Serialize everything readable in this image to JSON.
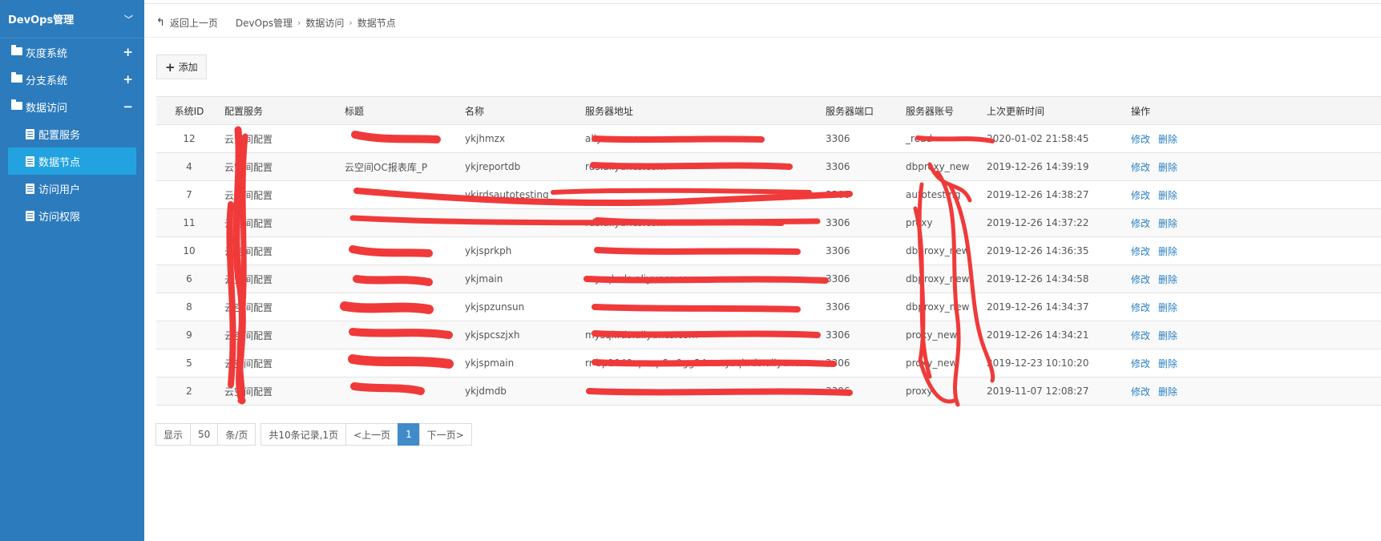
{
  "sidebar": {
    "title": "DevOps管理",
    "groups": [
      {
        "label": "灰度系统",
        "sign": "+"
      },
      {
        "label": "分支系统",
        "sign": "+"
      },
      {
        "label": "数据访问",
        "sign": "−"
      }
    ],
    "sub_items": [
      {
        "label": "配置服务"
      },
      {
        "label": "数据节点"
      },
      {
        "label": "访问用户"
      },
      {
        "label": "访问权限"
      }
    ]
  },
  "breadcrumb": {
    "back": "返回上一页",
    "items": [
      "DevOps管理",
      "数据访问",
      "数据节点"
    ]
  },
  "toolbar": {
    "add_label": "添加"
  },
  "table": {
    "headers": [
      "系统ID",
      "配置服务",
      "标题",
      "名称",
      "服务器地址",
      "服务器端口",
      "服务器账号",
      "上次更新时间",
      "操作"
    ],
    "rows": [
      {
        "id": "12",
        "service": "云空间配置",
        "title": "",
        "name": "ykjhmzx",
        "addr": "aliyuncs.com",
        "port": "3306",
        "account": "_read",
        "updated": "2020-01-02 21:58:45"
      },
      {
        "id": "4",
        "service": "云空间配置",
        "title": "云空间OC报表库_P",
        "name": "ykjreportdb",
        "addr": "rds.aliyuncs.com",
        "port": "3306",
        "account": "dbproxy_new",
        "updated": "2019-12-26 14:39:19"
      },
      {
        "id": "7",
        "service": "云空间配置",
        "title": "",
        "name": "ykjrdsautotesting",
        "addr": "",
        "port": "3306",
        "account": "autotesting",
        "updated": "2019-12-26 14:38:27"
      },
      {
        "id": "11",
        "service": "云空间配置",
        "title": "",
        "name": "",
        "addr": "rds.aliyuncs.com",
        "port": "3306",
        "account": "proxy",
        "updated": "2019-12-26 14:37:22"
      },
      {
        "id": "10",
        "service": "云空间配置",
        "title": "",
        "name": "ykjsprkph",
        "addr": "",
        "port": "3306",
        "account": "dbproxy_new",
        "updated": "2019-12-26 14:36:35"
      },
      {
        "id": "6",
        "service": "云空间配置",
        "title": "",
        "name": "ykjmain",
        "addr": "mysql.rds.aliyuncs.com",
        "port": "3306",
        "account": "dbproxy_new",
        "updated": "2019-12-26 14:34:58"
      },
      {
        "id": "8",
        "service": "云空间配置",
        "title": "",
        "name": "ykjspzunsun",
        "addr": "",
        "port": "3306",
        "account": "dbproxy_new",
        "updated": "2019-12-26 14:34:37"
      },
      {
        "id": "9",
        "service": "云空间配置",
        "title": "",
        "name": "ykjspcszjxh",
        "addr": "mysql.rds.aliyuncs.com",
        "port": "3306",
        "account": "proxy_new",
        "updated": "2019-12-26 14:34:21"
      },
      {
        "id": "5",
        "service": "云空间配置",
        "title": "",
        "name": "ykjspmain",
        "addr": "rr-bp1040epexp6w0gg24o.mysql.rds.aliyuncs.com",
        "port": "3306",
        "account": "proxy_new",
        "updated": "2019-12-23 10:10:20"
      },
      {
        "id": "2",
        "service": "云空间配置",
        "title": "",
        "name": "ykjdmdb",
        "addr": "",
        "port": "3306",
        "account": "proxy",
        "updated": "2019-11-07 12:08:27"
      }
    ],
    "actions": {
      "edit": "修改",
      "delete": "删除"
    }
  },
  "pagination": {
    "show": "显示",
    "page_size": "50",
    "per_page": "条/页",
    "summary": "共10条记录,1页",
    "prev": "<上一页",
    "current": "1",
    "next": "下一页>"
  },
  "colors": {
    "sidebar_bg": "#2c7bbd",
    "active_item": "#22a3e0",
    "link": "#2a7fc0",
    "current_page": "#428bca",
    "redaction": "#f03a3a"
  }
}
